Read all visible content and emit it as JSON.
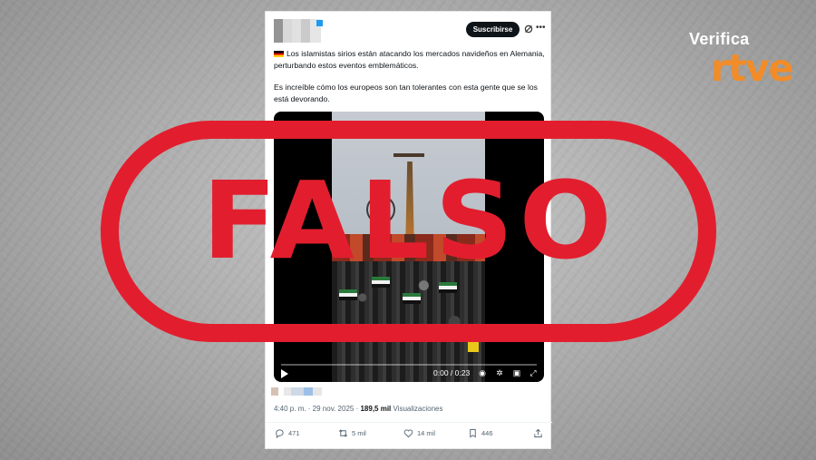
{
  "brand": {
    "verifica": "Verifica",
    "rtve": "rtve",
    "verifica_color": "#ffffff",
    "rtve_color": "#f28c28"
  },
  "tweet": {
    "subscribe_label": "Suscribirse",
    "flag_icon": "germany-flag-icon",
    "text_line1": "Los islamistas sirios están atacando los mercados navideños en Alemania, perturbando estos eventos emblemáticos.",
    "text_line2": "Es increíble cómo los europeos son tan tolerantes con esta gente que se los está devorando.",
    "video": {
      "time": "0:00 / 0:23"
    },
    "timestamp": "4:40 p. m. · 29 nov. 2025 · ",
    "views_count": "189,5 mil",
    "views_label": " Visualizaciones",
    "actions": {
      "replies": "471",
      "reposts": "5 mil",
      "likes": "14 mil",
      "bookmarks": "446"
    }
  },
  "stamp": {
    "word": "FALSO",
    "color": "#e21e2e"
  }
}
